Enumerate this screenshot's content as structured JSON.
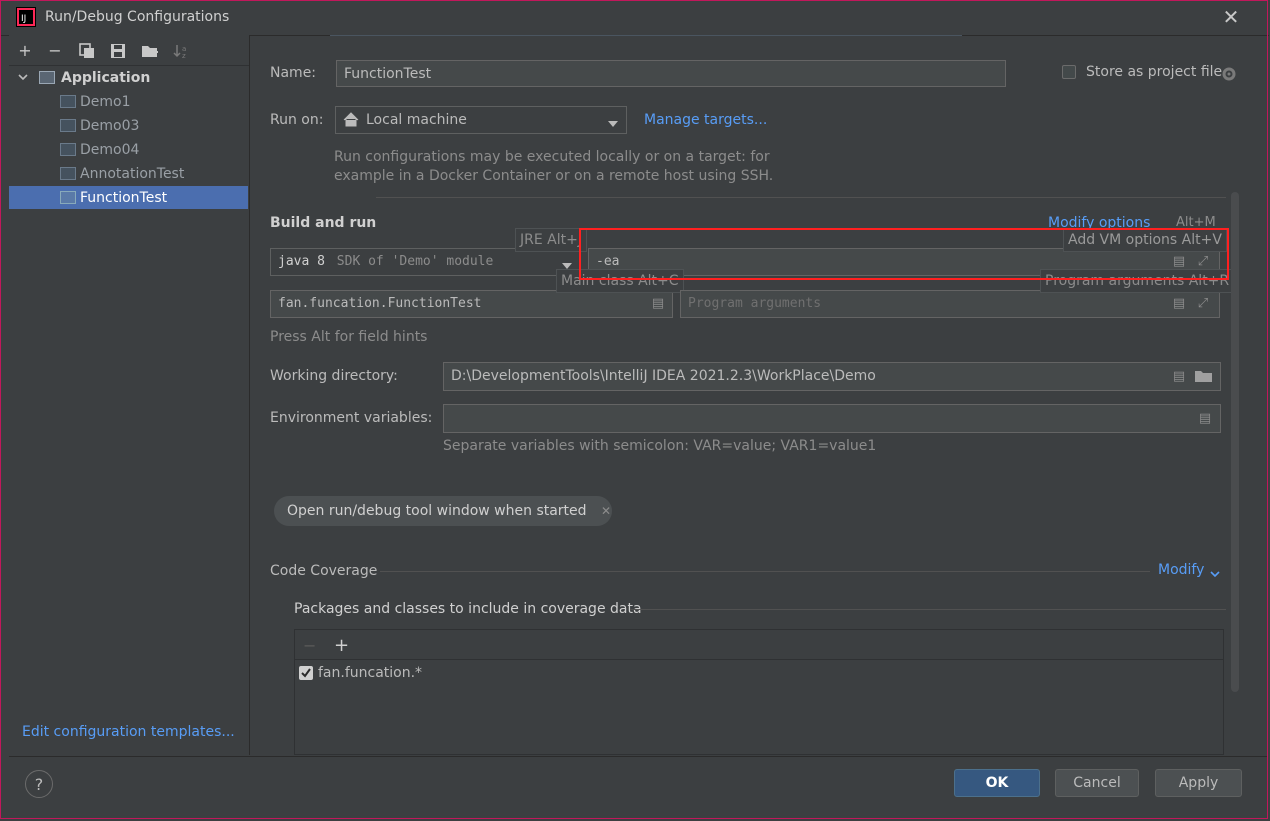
{
  "window": {
    "title": "Run/Debug Configurations",
    "close_glyph": "✕"
  },
  "toolbar": {
    "add": "+",
    "remove": "−",
    "copy": "⧉",
    "save": "🖫",
    "folder": "📁",
    "sort": "↓ᶻ"
  },
  "tree": {
    "root": "Application",
    "items": [
      "Demo1",
      "Demo03",
      "Demo04",
      "AnnotationTest",
      "FunctionTest"
    ]
  },
  "edit_templates": "Edit configuration templates...",
  "form": {
    "name_label": "Name:",
    "name_value": "FunctionTest",
    "store_label": "Store as project file",
    "run_on_label": "Run on:",
    "run_on_value": "Local machine",
    "manage_targets": "Manage targets...",
    "run_on_hint_1": "Run configurations may be executed locally or on a target: for",
    "run_on_hint_2": "example in a Docker Container or on a remote host using SSH.",
    "build_run_label": "Build and run",
    "modify_options": "Modify options",
    "modify_shortcut": "Alt+M",
    "jre_java": "java 8",
    "jre_desc": "SDK of 'Demo' module",
    "jre_popup": "JRE Alt+J",
    "vm_value": "-ea",
    "vm_popup": "Add VM options Alt+V",
    "main_class_value": "fan.funcation.FunctionTest",
    "main_class_popup": "Main class Alt+C",
    "program_args_placeholder": "Program arguments",
    "program_args_popup": "Program arguments Alt+R",
    "field_hints": "Press Alt for field hints",
    "working_dir_label": "Working directory:",
    "working_dir_value": "D:\\DevelopmentTools\\IntelliJ IDEA 2021.2.3\\WorkPlace\\Demo",
    "env_label": "Environment variables:",
    "env_value": "",
    "env_hint": "Separate variables with semicolon: VAR=value; VAR1=value1",
    "tag_label": "Open run/debug tool window when started",
    "tag_close": "✕",
    "coverage_label": "Code Coverage",
    "coverage_modify": "Modify",
    "coverage_packages_label": "Packages and classes to include in coverage data",
    "coverage_item": "fan.funcation.*"
  },
  "buttons": {
    "ok": "OK",
    "cancel": "Cancel",
    "apply": "Apply",
    "help": "?"
  }
}
